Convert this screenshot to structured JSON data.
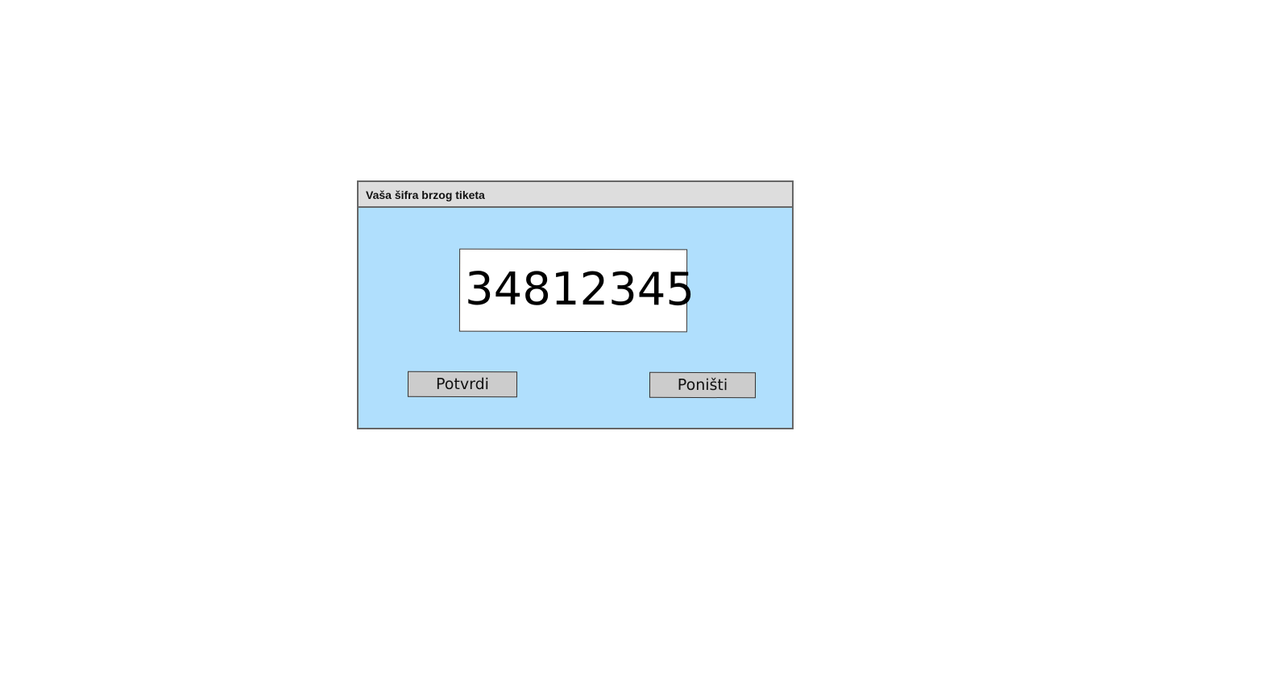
{
  "dialog": {
    "title": "Vaša šifra brzog tiketa",
    "ticket_code": "34812345",
    "confirm_label": "Potvrdi",
    "cancel_label": "Poništi"
  },
  "colors": {
    "dialog_background": "#b0dffd",
    "titlebar_background": "#dddddd",
    "button_background": "#cccccc",
    "border": "#666666"
  }
}
